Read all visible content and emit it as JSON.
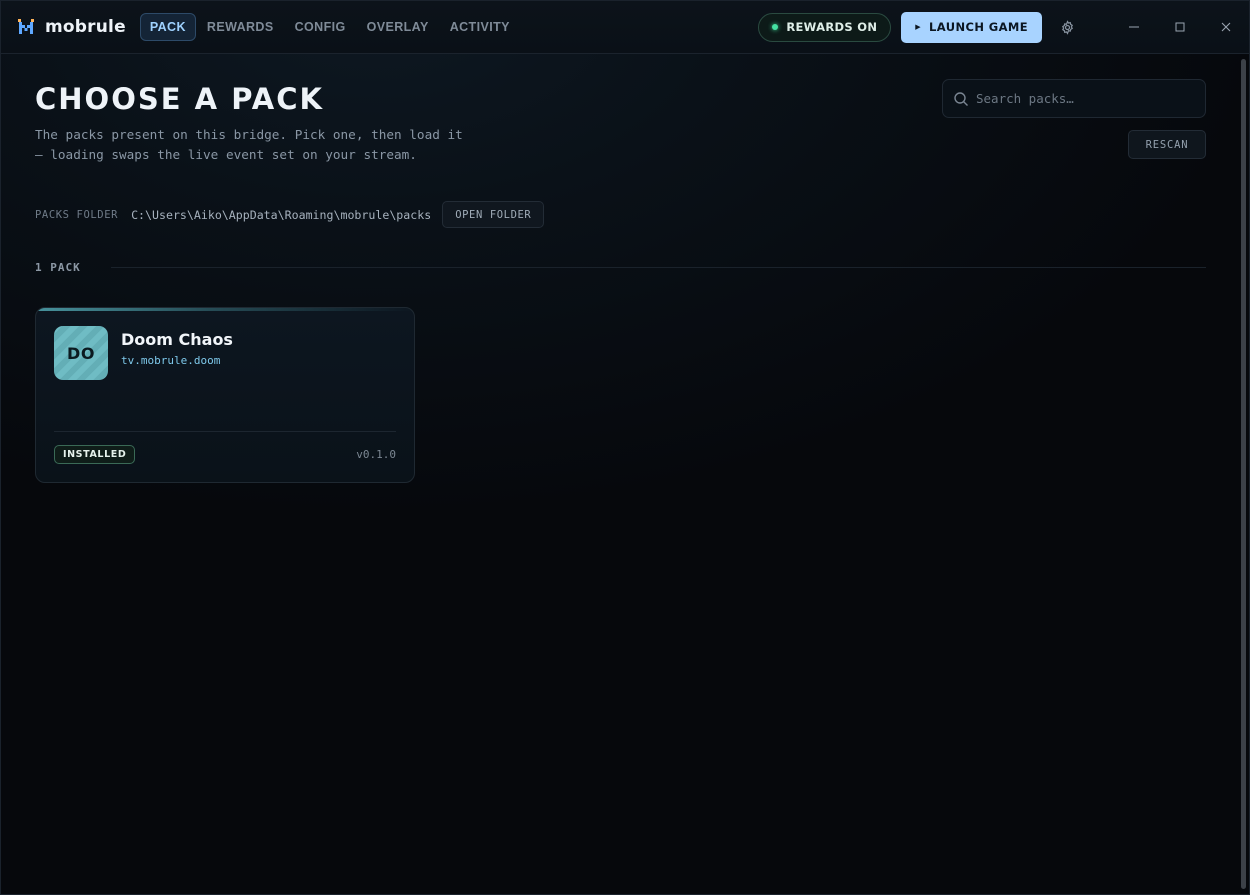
{
  "app": {
    "name": "mobrule",
    "logo_icon": "mobrule-logo-icon"
  },
  "nav": {
    "tabs": [
      {
        "label": "PACK",
        "active": true
      },
      {
        "label": "REWARDS",
        "active": false
      },
      {
        "label": "CONFIG",
        "active": false
      },
      {
        "label": "OVERLAY",
        "active": false
      },
      {
        "label": "ACTIVITY",
        "active": false
      }
    ]
  },
  "toolbar": {
    "rewards_label": "REWARDS ON",
    "rewards_status_color": "#45e2a2",
    "launch_label": "LAUNCH GAME",
    "launch_icon": "play-icon",
    "settings_icon": "gear-icon"
  },
  "window_controls": {
    "minimize_icon": "minimize-icon",
    "maximize_icon": "maximize-icon",
    "close_icon": "close-icon"
  },
  "page": {
    "title": "CHOOSE A PACK",
    "subtitle": "The packs present on this bridge. Pick one, then load it — loading swaps the live event set on your stream."
  },
  "search": {
    "placeholder": "Search packs…",
    "value": "",
    "icon": "search-icon"
  },
  "rescan_label": "RESCAN",
  "packs_folder": {
    "label": "PACKS FOLDER",
    "path": "C:\\Users\\Aiko\\AppData\\Roaming\\mobrule\\packs",
    "open_label": "OPEN FOLDER"
  },
  "pack_count_label": "1 PACK",
  "packs": [
    {
      "initials": "DO",
      "name": "Doom Chaos",
      "id": "tv.mobrule.doom",
      "status": "INSTALLED",
      "version": "v0.1.0",
      "thumb_color": "#6fbcc4"
    }
  ],
  "colors": {
    "accent": "#a8d3ff",
    "active_tab_text": "#9fd2ff",
    "pack_id": "#7ec8ea",
    "background": "#06080c"
  }
}
